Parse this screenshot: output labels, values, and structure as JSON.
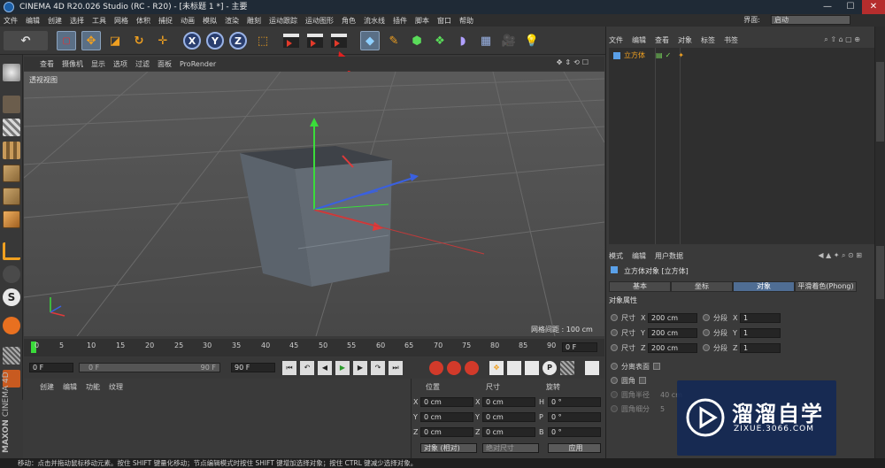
{
  "window": {
    "title": "CINEMA 4D R20.026 Studio (RC - R20) - [未标题 1 *] - 主要",
    "min": "—",
    "max": "☐",
    "close": "✕"
  },
  "menu": [
    "文件",
    "编辑",
    "创建",
    "选择",
    "工具",
    "网格",
    "体积",
    "捕捉",
    "动画",
    "模拟",
    "渲染",
    "雕刻",
    "运动跟踪",
    "运动图形",
    "角色",
    "流水线",
    "插件",
    "脚本",
    "窗口",
    "帮助"
  ],
  "layout": {
    "label": "界面:",
    "value": "启动"
  },
  "toolbar": {
    "axes": [
      "X",
      "Y",
      "Z"
    ]
  },
  "viewport": {
    "menu": [
      "查看",
      "摄像机",
      "显示",
      "选项",
      "过滤",
      "面板",
      "ProRender"
    ],
    "label": "透视视图",
    "grid_spacing": "网格间距 : 100 cm"
  },
  "timeline": {
    "ticks": [
      "0",
      "5",
      "10",
      "15",
      "20",
      "25",
      "30",
      "35",
      "40",
      "45",
      "50",
      "55",
      "60",
      "65",
      "70",
      "75",
      "80",
      "85",
      "90"
    ],
    "frame_field": "0 F"
  },
  "playback": {
    "start": "0 F",
    "range_start": "0 F",
    "range_end": "90 F",
    "end": "90 F"
  },
  "materials": {
    "menu": [
      "创建",
      "编辑",
      "功能",
      "纹理"
    ]
  },
  "coords": {
    "headers": [
      "位置",
      "尺寸",
      "旋转"
    ],
    "rows": [
      {
        "a": "X",
        "v1": "0 cm",
        "b": "X",
        "v2": "0 cm",
        "c": "H",
        "v3": "0 °"
      },
      {
        "a": "Y",
        "v1": "0 cm",
        "b": "Y",
        "v2": "0 cm",
        "c": "P",
        "v3": "0 °"
      },
      {
        "a": "Z",
        "v1": "0 cm",
        "b": "Z",
        "v2": "0 cm",
        "c": "B",
        "v3": "0 °"
      }
    ],
    "mode": "对象 (相对)",
    "size_mode": "绝对尺寸",
    "apply": "应用"
  },
  "objects": {
    "menu": [
      "文件",
      "编辑",
      "查看",
      "对象",
      "标签",
      "书签"
    ],
    "item": "立方体"
  },
  "attributes": {
    "menu": [
      "模式",
      "编辑",
      "用户数据"
    ],
    "title": "立方体对象 [立方体]",
    "tabs": [
      "基本",
      "坐标",
      "对象",
      "平滑着色(Phong)"
    ],
    "active_tab": "对象",
    "section": "对象属性",
    "size_label": "尺寸",
    "seg_label": "分段",
    "rows": [
      {
        "axis": "X",
        "size": "200 cm",
        "seg": "1"
      },
      {
        "axis": "Y",
        "size": "200 cm",
        "seg": "1"
      },
      {
        "axis": "Z",
        "size": "200 cm",
        "seg": "1"
      }
    ],
    "separate": "分离表面",
    "fillet": "圆角",
    "fillet_radius": "圆角半径",
    "fillet_radius_val": "40 cm",
    "fillet_sub": "圆角细分",
    "fillet_sub_val": "5"
  },
  "status": "移动：点击并拖动鼠标移动元素。按住 SHIFT 键量化移动；节点编辑模式时按住 SHIFT 键增加选择对象；按住 CTRL 键减少选择对象。",
  "brand": {
    "line1": "MAXON",
    "line2": "CINEMA 4D"
  },
  "watermark": {
    "name": "溜溜自学",
    "url": "ZIXUE.3066.COM"
  },
  "colors": {
    "accent": "#f0a020",
    "selection": "#4f6d93",
    "y_axis": "#3adc3a",
    "x_axis": "#e03a3a",
    "z_axis": "#3a60e0"
  }
}
